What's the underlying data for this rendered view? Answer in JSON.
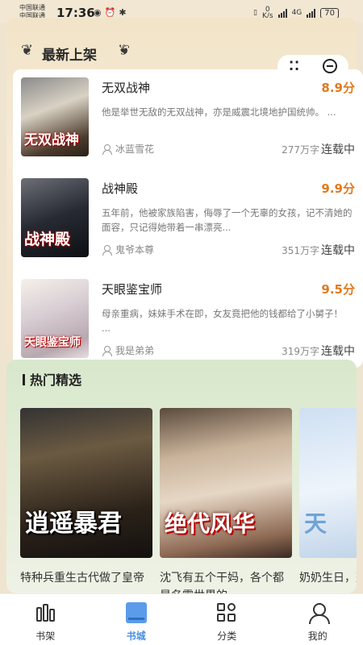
{
  "status_bar": {
    "carrier_1": "中国联通",
    "carrier_2": "中国联通",
    "time": "17:36",
    "net_speed_value": "0",
    "net_speed_unit": "K/s",
    "network_type": "4G",
    "battery": "70"
  },
  "new_arrivals": {
    "title": "最新上架",
    "books": [
      {
        "title": "无双战神",
        "score": "8.9分",
        "desc": "他是举世无敌的无双战神，亦是威震北境地护国统帅。 ...",
        "author": "冰蓝雪花",
        "word_count": "277万字",
        "status": "连载中",
        "cover_text": "无双战神"
      },
      {
        "title": "战神殿",
        "score": "9.9分",
        "desc": "五年前，他被家族陷害，侮辱了一个无辜的女孩，记不清她的面容，只记得她带着一串漂亮...",
        "author": "鬼爷本尊",
        "word_count": "351万字",
        "status": "连载中",
        "cover_text": "战神殿"
      },
      {
        "title": "天眼鉴宝师",
        "score": "9.5分",
        "desc": "母亲重病，妹妹手术在即，女友竟把他的钱都给了小舅子！ ...",
        "author": "我是弟弟",
        "word_count": "319万字",
        "status": "连载中",
        "cover_text": "天眼鉴宝师"
      }
    ]
  },
  "hot_picks": {
    "title": "热门精选",
    "books": [
      {
        "cover_text": "逍遥暴君",
        "desc": "特种兵重生古代做了皇帝"
      },
      {
        "cover_text": "绝代风华",
        "desc": "沈飞有五个干妈，各个都是名震世界的"
      },
      {
        "cover_text": "天",
        "desc": "奶奶生日，整顿的钱"
      }
    ]
  },
  "tab_bar": {
    "tabs": [
      {
        "label": "书架",
        "icon": "bookshelf-icon",
        "active": false
      },
      {
        "label": "书城",
        "icon": "book-store-icon",
        "active": true
      },
      {
        "label": "分类",
        "icon": "category-grid-icon",
        "active": false
      },
      {
        "label": "我的",
        "icon": "profile-icon",
        "active": false
      }
    ],
    "active_color": "#4a90e2"
  },
  "colors": {
    "score": "#e07a1f",
    "hot_bg": "#d8e8cc",
    "new_bg": "#f1e4c8"
  }
}
